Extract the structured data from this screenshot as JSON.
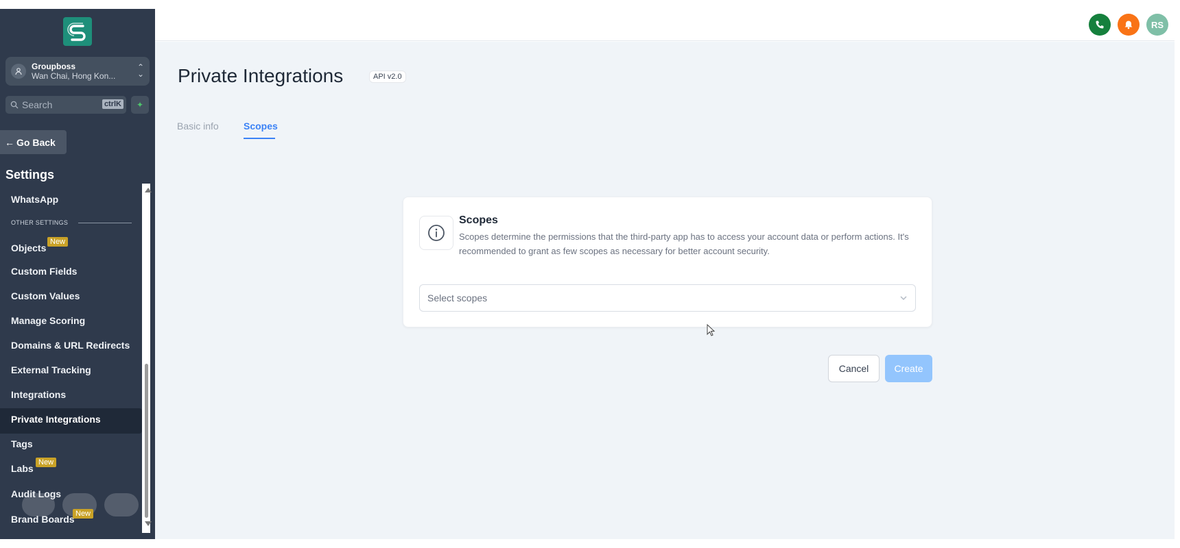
{
  "sidebar": {
    "account": {
      "name": "Groupboss",
      "location": "Wan Chai, Hong Kon..."
    },
    "search": {
      "placeholder": "Search",
      "shortcut": "ctrlK"
    },
    "go_back": "Go Back",
    "settings_title": "Settings",
    "section_label": "OTHER SETTINGS",
    "items": [
      {
        "label": "WhatsApp"
      },
      {
        "label": "Objects",
        "badge": "New"
      },
      {
        "label": "Custom Fields"
      },
      {
        "label": "Custom Values"
      },
      {
        "label": "Manage Scoring"
      },
      {
        "label": "Domains & URL Redirects"
      },
      {
        "label": "External Tracking"
      },
      {
        "label": "Integrations"
      },
      {
        "label": "Private Integrations",
        "active": true
      },
      {
        "label": "Tags"
      },
      {
        "label": "Labs",
        "badge": "New"
      },
      {
        "label": "Audit Logs"
      },
      {
        "label": "Brand Boards",
        "badge": "New"
      }
    ]
  },
  "topbar": {
    "icons": [
      "phone-icon",
      "bell-icon"
    ],
    "user_initials": "RS",
    "colors": {
      "phone": "#15803d",
      "bell": "#f97316",
      "user": "#7fbfa7"
    }
  },
  "main": {
    "title": "Private Integrations",
    "api_badge": "API v2.0",
    "tabs": [
      {
        "label": "Basic info",
        "active": false
      },
      {
        "label": "Scopes",
        "active": true
      }
    ],
    "card": {
      "title": "Scopes",
      "description": "Scopes determine the permissions that the third-party app has to access your account data or perform actions. It's recommended to grant as few scopes as necessary for better account security.",
      "select_placeholder": "Select scopes"
    },
    "buttons": {
      "cancel": "Cancel",
      "create": "Create"
    }
  },
  "colors": {
    "sidebar_bg": "#2f3a4c",
    "accent": "#3b82f6",
    "main_bg": "#f0f4f8",
    "badge_new": "#c9a227"
  }
}
